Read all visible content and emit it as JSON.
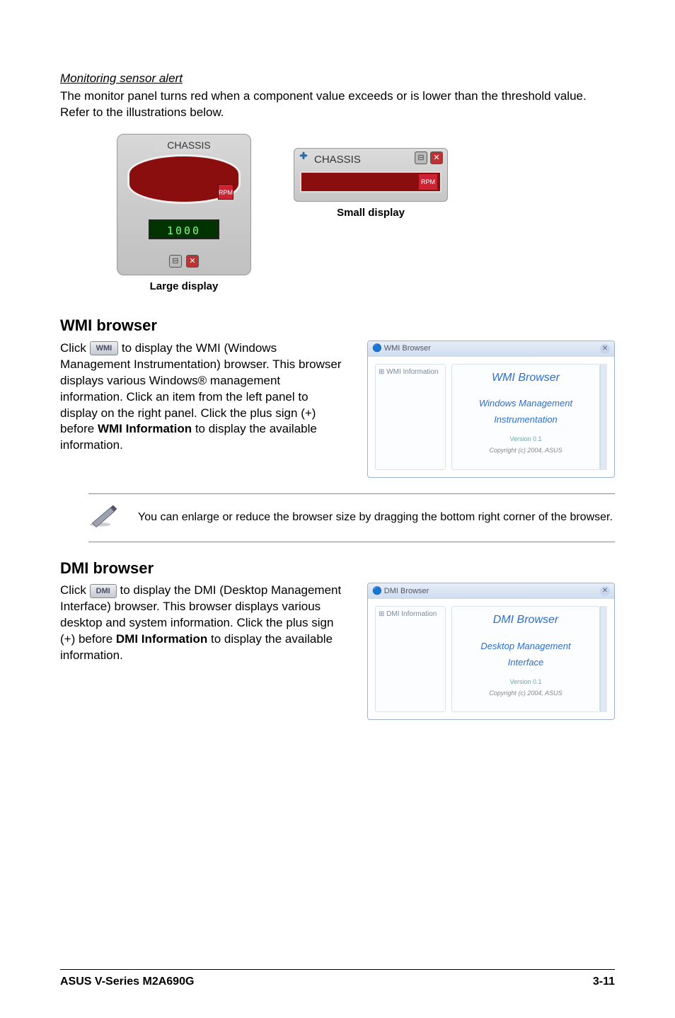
{
  "monitoring": {
    "heading": "Monitoring sensor alert",
    "para": "The monitor panel turns red when a component value exceeds or is lower than the threshold value. Refer to the illustrations below.",
    "chassis_label": "CHASSIS",
    "rpm_label": "RPM",
    "digits": "1000",
    "large_caption": "Large display",
    "small_caption": "Small display"
  },
  "wmi": {
    "heading": "WMI browser",
    "btn": "WMI",
    "text_before": "Click ",
    "text_after_1": " to display the WMI (Windows Management Instrumentation) browser. This browser displays various Windows",
    "reg": "®",
    "text_after_2": " management information. Click an item from the left panel to display on the right panel. Click the plus sign (+) before ",
    "bold_term": "WMI Information",
    "text_after_3": " to display the available information.",
    "window_title": "WMI Browser",
    "tree_root": "WMI Information",
    "panel_title": "WMI Browser",
    "panel_sub1": "Windows Management",
    "panel_sub2": "Instrumentation",
    "panel_ver": "Version 0.1",
    "panel_cpy": "Copyright (c) 2004, ASUS"
  },
  "note": {
    "text": "You can enlarge or reduce the browser size by dragging the bottom right corner of the browser."
  },
  "dmi": {
    "heading": "DMI browser",
    "btn": "DMI",
    "text_before": "Click ",
    "text_after_1": " to display the DMI (Desktop Management Interface) browser. This browser displays various desktop and system information. Click the plus sign (+) before ",
    "bold_term": "DMI Information",
    "text_after_2": " to display the available information.",
    "window_title": "DMI Browser",
    "tree_root": "DMI Information",
    "panel_title": "DMI Browser",
    "panel_sub1": "Desktop Management",
    "panel_sub2": "Interface",
    "panel_ver": "Version 0.1",
    "panel_cpy": "Copyright (c) 2004, ASUS"
  },
  "footer": {
    "left": "ASUS V-Series M2A690G",
    "right": "3-11"
  }
}
